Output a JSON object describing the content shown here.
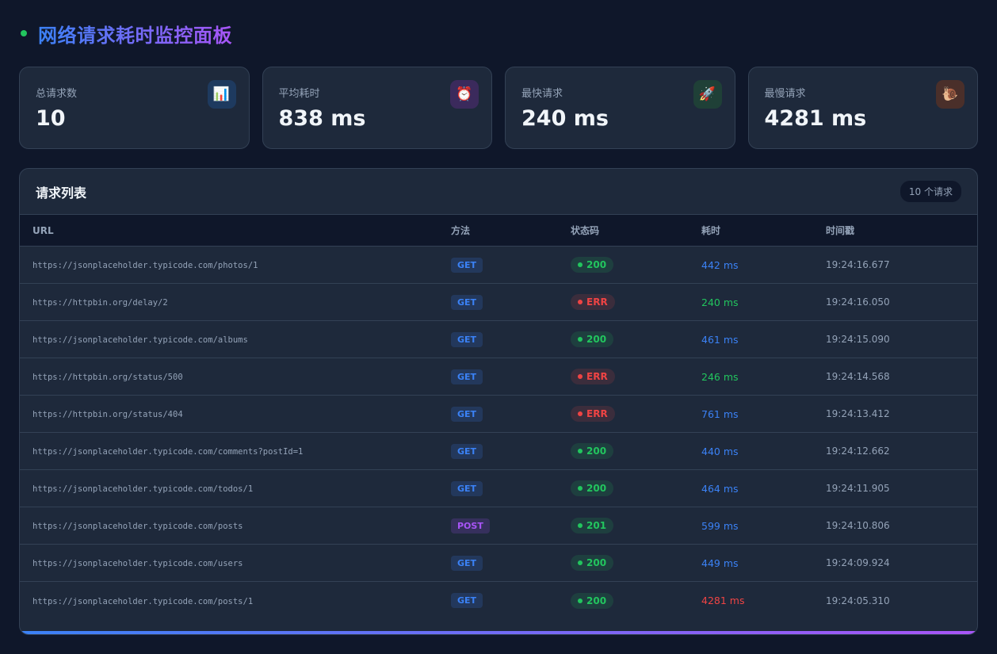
{
  "header": {
    "title": "网络请求耗时监控面板"
  },
  "stats": [
    {
      "label": "总请求数",
      "value": "10",
      "icon": "chart-icon",
      "glyph": "📊",
      "bg": "#1e3a5f"
    },
    {
      "label": "平均耗时",
      "value": "838 ms",
      "icon": "alarm-clock-icon",
      "glyph": "⏰",
      "bg": "#3b2a5c"
    },
    {
      "label": "最快请求",
      "value": "240 ms",
      "icon": "rocket-icon",
      "glyph": "🚀",
      "bg": "#1f4037"
    },
    {
      "label": "最慢请求",
      "value": "4281 ms",
      "icon": "snail-icon",
      "glyph": "🐌",
      "bg": "#4a2f2a"
    }
  ],
  "panel": {
    "title": "请求列表",
    "count": "10 个请求",
    "columns": {
      "url": "URL",
      "method": "方法",
      "status": "状态码",
      "duration": "耗时",
      "timestamp": "时间戳"
    }
  },
  "rows": [
    {
      "url": "https://jsonplaceholder.typicode.com/photos/1",
      "method": "GET",
      "status": "200",
      "ok": true,
      "duration": "442 ms",
      "speed": "normal",
      "timestamp": "19:24:16.677"
    },
    {
      "url": "https://httpbin.org/delay/2",
      "method": "GET",
      "status": "ERR",
      "ok": false,
      "duration": "240 ms",
      "speed": "fast",
      "timestamp": "19:24:16.050"
    },
    {
      "url": "https://jsonplaceholder.typicode.com/albums",
      "method": "GET",
      "status": "200",
      "ok": true,
      "duration": "461 ms",
      "speed": "normal",
      "timestamp": "19:24:15.090"
    },
    {
      "url": "https://httpbin.org/status/500",
      "method": "GET",
      "status": "ERR",
      "ok": false,
      "duration": "246 ms",
      "speed": "fast",
      "timestamp": "19:24:14.568"
    },
    {
      "url": "https://httpbin.org/status/404",
      "method": "GET",
      "status": "ERR",
      "ok": false,
      "duration": "761 ms",
      "speed": "normal",
      "timestamp": "19:24:13.412"
    },
    {
      "url": "https://jsonplaceholder.typicode.com/comments?postId=1",
      "method": "GET",
      "status": "200",
      "ok": true,
      "duration": "440 ms",
      "speed": "normal",
      "timestamp": "19:24:12.662"
    },
    {
      "url": "https://jsonplaceholder.typicode.com/todos/1",
      "method": "GET",
      "status": "200",
      "ok": true,
      "duration": "464 ms",
      "speed": "normal",
      "timestamp": "19:24:11.905"
    },
    {
      "url": "https://jsonplaceholder.typicode.com/posts",
      "method": "POST",
      "status": "201",
      "ok": true,
      "duration": "599 ms",
      "speed": "normal",
      "timestamp": "19:24:10.806"
    },
    {
      "url": "https://jsonplaceholder.typicode.com/users",
      "method": "GET",
      "status": "200",
      "ok": true,
      "duration": "449 ms",
      "speed": "normal",
      "timestamp": "19:24:09.924"
    },
    {
      "url": "https://jsonplaceholder.typicode.com/posts/1",
      "method": "GET",
      "status": "200",
      "ok": true,
      "duration": "4281 ms",
      "speed": "slow",
      "timestamp": "19:24:05.310"
    }
  ],
  "colors": {
    "accent_blue": "#3b82f6",
    "accent_purple": "#a855f7",
    "success": "#22c55e",
    "error": "#ef4444",
    "background": "#0f172a",
    "card": "#1e293b"
  }
}
